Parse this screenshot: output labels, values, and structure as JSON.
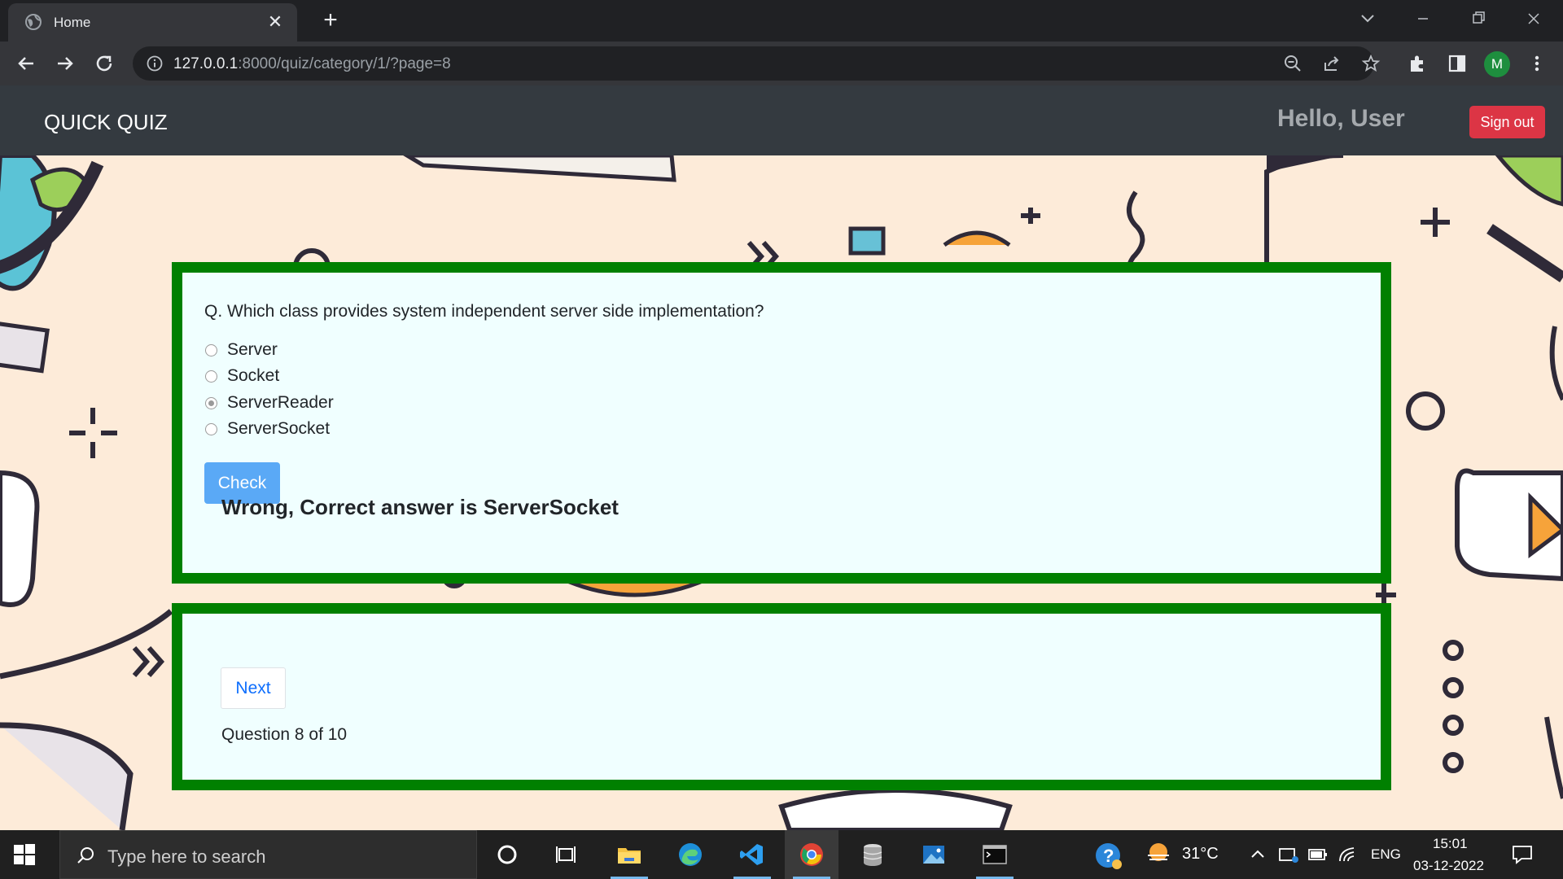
{
  "browser": {
    "tab_title": "Home",
    "url_host": "127.0.0.1",
    "url_rest": ":8000/quiz/category/1/?page=8",
    "profile_initial": "M"
  },
  "navbar": {
    "brand": "QUICK QUIZ",
    "greeting": "Hello, User",
    "signout_label": "Sign out"
  },
  "quiz": {
    "question": "Q. Which class provides system independent server side implementation?",
    "options": [
      {
        "label": "Server",
        "selected": false
      },
      {
        "label": "Socket",
        "selected": false
      },
      {
        "label": "ServerReader",
        "selected": true
      },
      {
        "label": "ServerSocket",
        "selected": false
      }
    ],
    "check_label": "Check",
    "result": "Wrong, Correct answer is ServerSocket"
  },
  "pager": {
    "next_label": "Next",
    "counter": "Question 8 of 10"
  },
  "taskbar": {
    "search_placeholder": "Type here to search",
    "temperature": "31°C",
    "language": "ENG",
    "time": "15:01",
    "date": "03-12-2022"
  },
  "colors": {
    "card_border": "#008000",
    "card_bg": "#f0ffff",
    "page_bg": "#fdebd9",
    "signout": "#dc3545",
    "check": "#5aa9f6"
  }
}
